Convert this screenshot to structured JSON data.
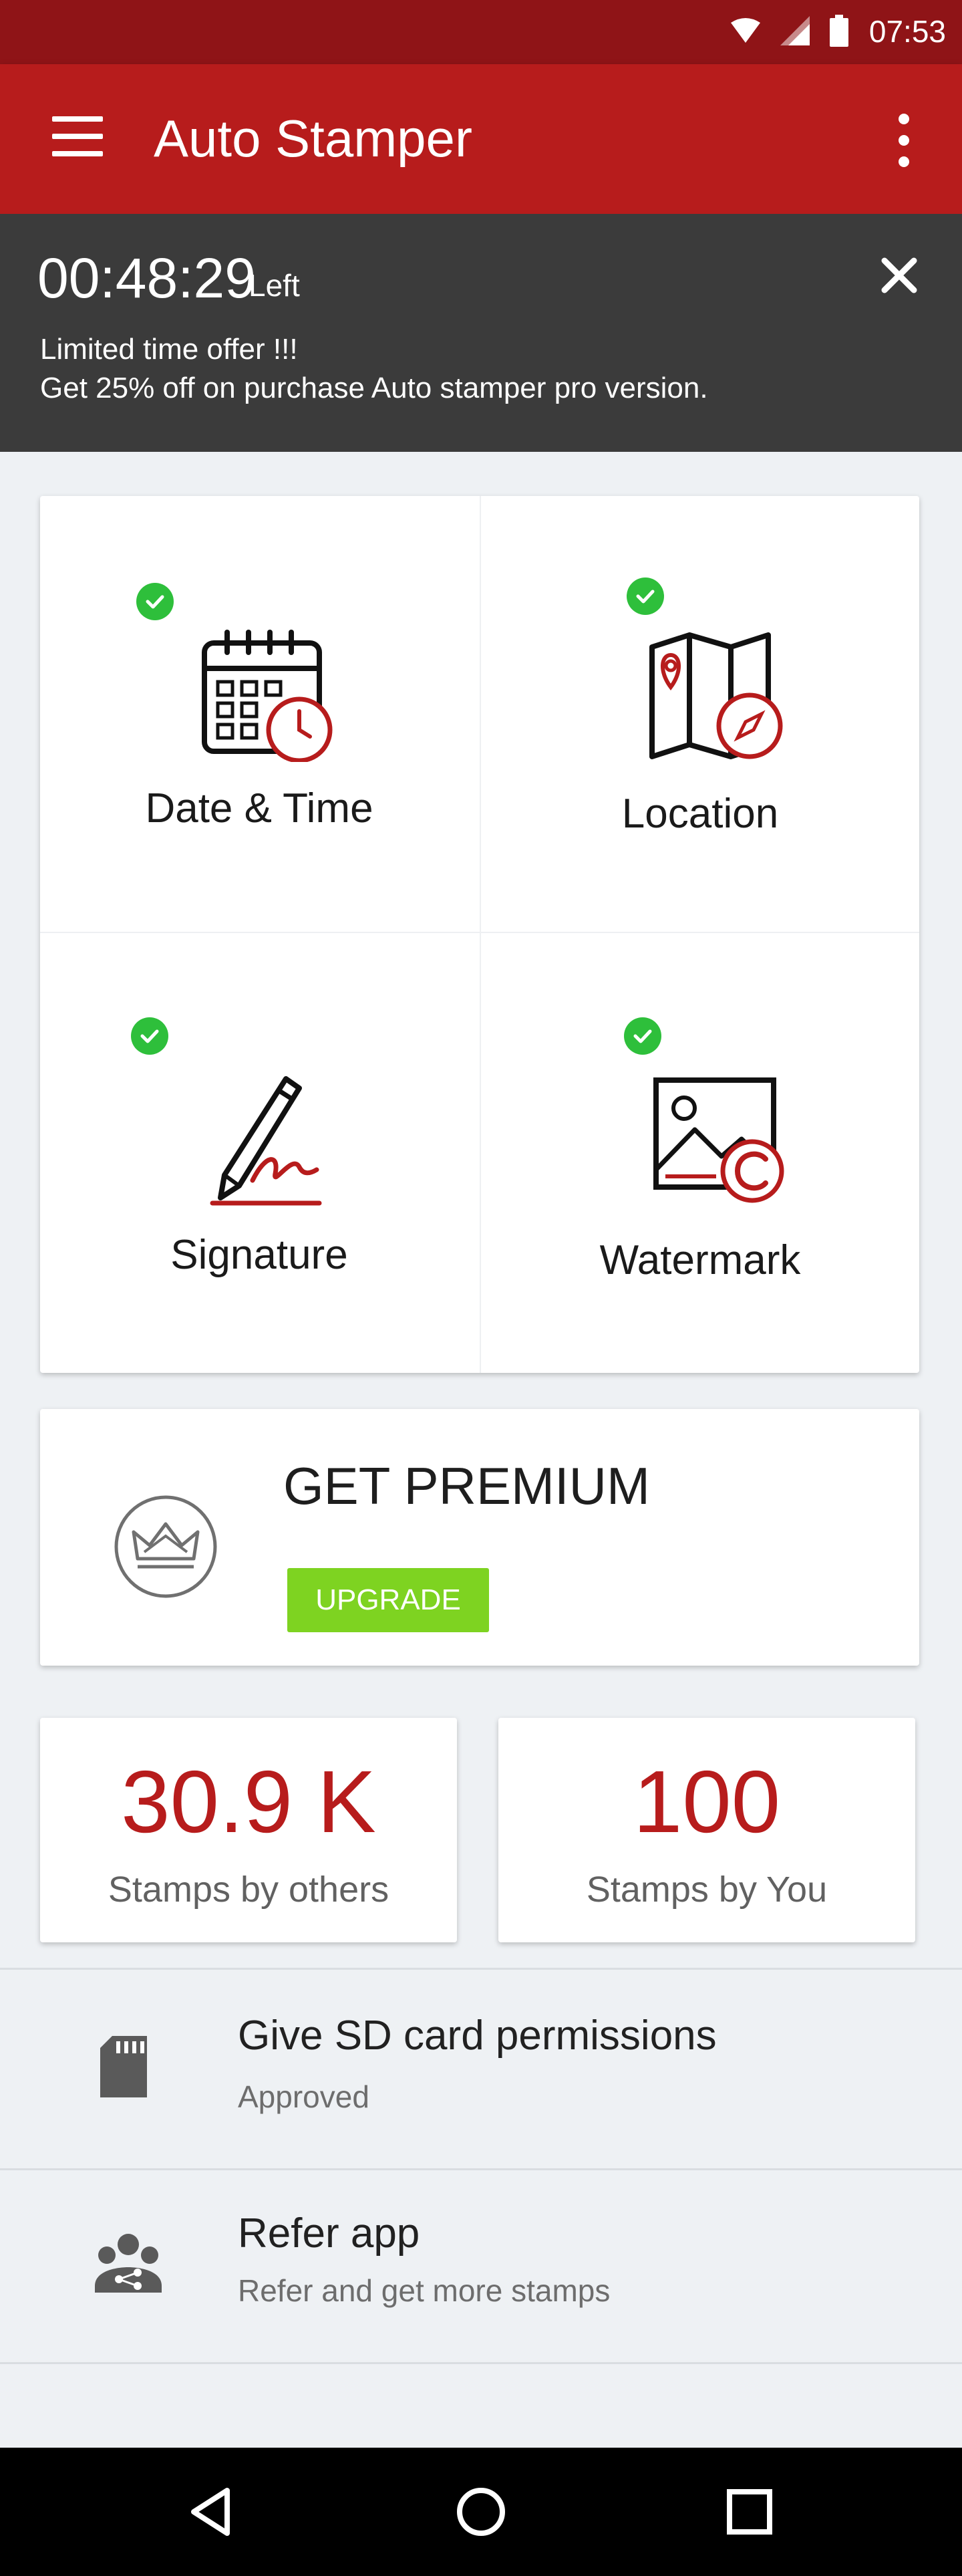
{
  "status_bar": {
    "time": "07:53",
    "icons": [
      "wifi-icon",
      "signal-icon",
      "battery-icon"
    ]
  },
  "app_bar": {
    "title": "Auto Stamper",
    "menu_icon": "hamburger-menu-icon",
    "more_icon": "more-vert-icon"
  },
  "offer": {
    "countdown": "00:48:29",
    "countdown_suffix": "Left",
    "line1": "Limited time offer !!!",
    "line2": "Get 25% off on purchase Auto stamper pro version."
  },
  "features": [
    {
      "label": "Date & Time",
      "icon": "calendar-clock-icon",
      "enabled": true
    },
    {
      "label": "Location",
      "icon": "map-compass-icon",
      "enabled": true
    },
    {
      "label": "Signature",
      "icon": "pen-signature-icon",
      "enabled": true
    },
    {
      "label": "Watermark",
      "icon": "image-copyright-icon",
      "enabled": true
    }
  ],
  "premium": {
    "title": "GET PREMIUM",
    "button": "UPGRADE",
    "icon": "crown-icon"
  },
  "stats": [
    {
      "value": "30.9 K",
      "caption": "Stamps by others"
    },
    {
      "value": "100",
      "caption": "Stamps by You"
    }
  ],
  "list": [
    {
      "title": "Give SD card permissions",
      "subtitle": "Approved",
      "icon": "sd-card-icon"
    },
    {
      "title": "Refer app",
      "subtitle": "Refer and get more stamps",
      "icon": "share-group-icon"
    }
  ],
  "colors": {
    "primary": "#b71c1c",
    "status_bar": "#8f1417",
    "banner": "#3b3b3b",
    "check": "#2ebf3b",
    "upgrade": "#7ed321"
  },
  "nav_bar": {
    "buttons": [
      "back-icon",
      "home-icon",
      "recents-icon"
    ]
  }
}
